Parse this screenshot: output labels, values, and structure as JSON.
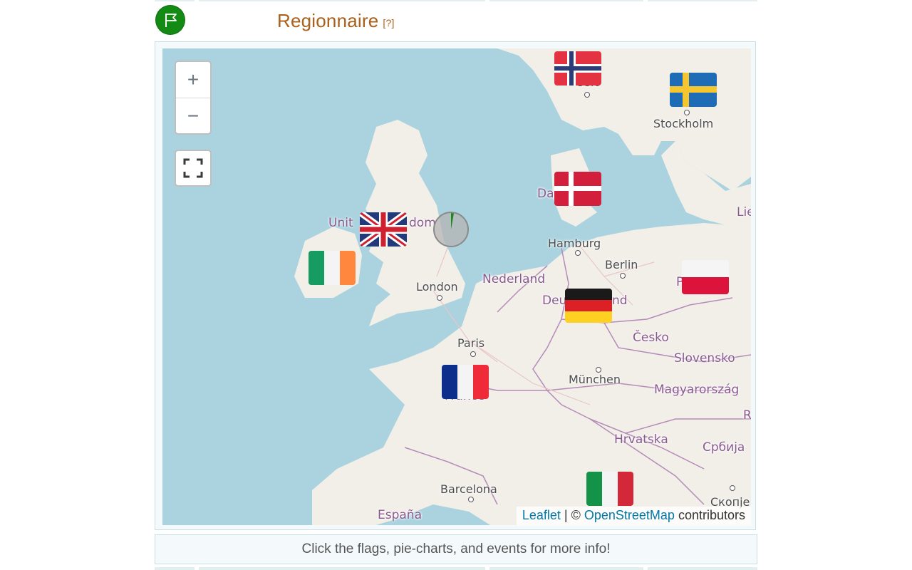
{
  "header": {
    "title": "Regionnaire",
    "help": "[?]",
    "badge_icon": "flag-icon",
    "badge_color": "#138a13"
  },
  "map": {
    "zoom_in": "+",
    "zoom_out": "−",
    "fullscreen_icon": "fullscreen-icon",
    "attribution": {
      "leaflet": "Leaflet",
      "sep": " | © ",
      "osm": "OpenStreetMap",
      "rest": " contributors"
    },
    "labels": {
      "oslo": "Oslo",
      "stockholm": "Stockholm",
      "danmark": "Da",
      "uk_left": "Unit",
      "uk_right": "dom",
      "hamburg": "Hamburg",
      "berlin": "Berlin",
      "nederland": "Nederland",
      "london": "London",
      "deutschland_left": "Deu",
      "deutschland_right": "nd",
      "polska": "P",
      "lietuva": "Lie",
      "paris": "Paris",
      "france": "France",
      "cesko": "Česko",
      "slovensko": "Slovensko",
      "munchen": "München",
      "magyarorszag": "Magyarország",
      "hrvatska": "Hrvatska",
      "srbija": "Србија",
      "barcelona": "Barcelona",
      "espana": "España",
      "skopje": "Скопје",
      "r": "R"
    },
    "flags": [
      {
        "country": "Norway",
        "icon": "norway-flag-icon"
      },
      {
        "country": "Sweden",
        "icon": "sweden-flag-icon"
      },
      {
        "country": "Denmark",
        "icon": "denmark-flag-icon"
      },
      {
        "country": "United Kingdom",
        "icon": "uk-flag-icon"
      },
      {
        "country": "Ireland",
        "icon": "ireland-flag-icon"
      },
      {
        "country": "Germany",
        "icon": "germany-flag-icon"
      },
      {
        "country": "Poland",
        "icon": "poland-flag-icon"
      },
      {
        "country": "France",
        "icon": "france-flag-icon"
      },
      {
        "country": "Italy",
        "icon": "italy-flag-icon"
      }
    ],
    "colors": {
      "sea": "#aad3df",
      "land": "#f2efe9",
      "border": "#b58bb8"
    }
  },
  "info": {
    "text": "Click the flags, pie-charts, and events for more info!"
  }
}
